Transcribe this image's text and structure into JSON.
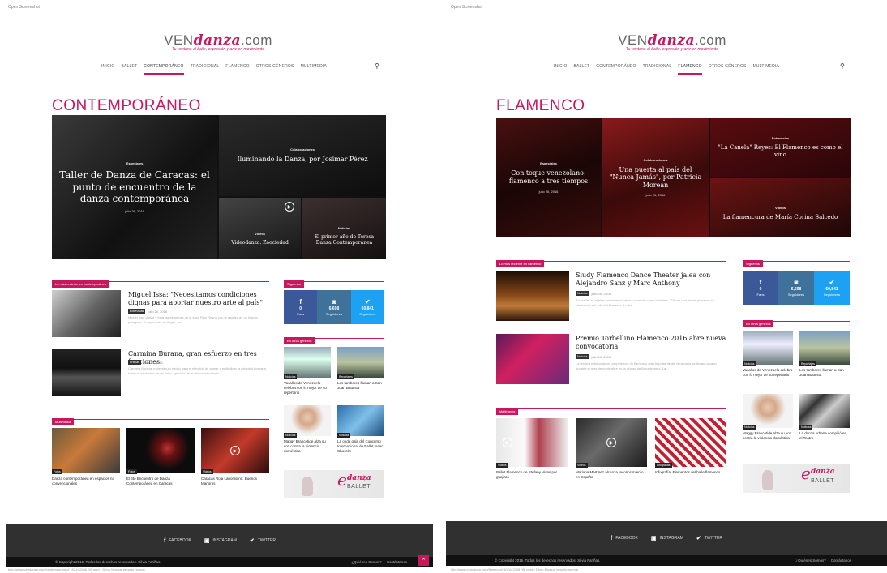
{
  "header": {
    "logo_ven": "VEN",
    "logo_danza": "danza",
    "logo_com": ".com",
    "tagline": "Tu ventana al baile, expresión y arte en movimiento",
    "search_icon": "search-icon"
  },
  "nav": [
    "INICIO",
    "BALLET",
    "CONTEMPORÁNEO",
    "TRADICIONAL",
    "FLAMENCO",
    "OTROS GÉNEROS",
    "MULTIMEDIA"
  ],
  "left": {
    "top_caption": "Open Screenshot",
    "page_title": "CONTEMPORÁNEO",
    "active_nav": "CONTEMPORÁNEO",
    "hero": [
      {
        "tag": "Especiales",
        "title": "Taller de Danza de Caracas: el punto de encuentro de la danza contemporánea",
        "date": "julio 26, 2016"
      },
      {
        "tag": "Colaboraciones",
        "title": "Iluminando la Danza, por Josimar Pérez"
      },
      {
        "tag": "Videos",
        "title": "Videodanza: Zoociedad"
      },
      {
        "tag": "Noticias",
        "title": "El primer año de Teresa Danza Contemporánea"
      }
    ],
    "latest_head": "Lo más reciente en contemporáneo",
    "articles": [
      {
        "title": "Miguel Issa: \"Necesitamos condiciones dignas para aportar nuestro arte al país\"",
        "cat": "Entrevistas",
        "date": "julio 26, 2016",
        "excerpt": "Miguel Issa danza y baja las escaleras de la casa Ríos Reyna con la rapidez de un halcón peregrino. Aunque está de negro, no..."
      },
      {
        "title": "Carmina Burana, gran esfuerzo en tres funciones",
        "cat": "Críticas",
        "date": "julio 26, 2016",
        "excerpt": "Carmina Burana, espectáculo hecho para el ejercicio de sumar y multiplicar la voluntad humana sobre el escenario en un único ejercicio de fe del conservatorio..."
      }
    ],
    "multimedia_head": "Multimedia",
    "multimedia": [
      {
        "cat": "Fotos",
        "caption": "Danza contemporánea en espacios no convencionales"
      },
      {
        "cat": "Fotos",
        "caption": "El 6to Encuentro de Danza Contemporánea en Caracas"
      },
      {
        "cat": "Videos",
        "caption": "Caracas Roja Laboratorio: Buenos Manoros"
      }
    ],
    "follow_head": "Síguenos",
    "social": [
      {
        "icon": "f",
        "count": "0",
        "label": "Fans"
      },
      {
        "icon": "◙",
        "count": "6,698",
        "label": "Seguidores"
      },
      {
        "icon": "✔",
        "count": "60,841",
        "label": "Seguidores"
      }
    ],
    "others_head": "En otros géneros",
    "others": [
      {
        "cat": "Noticias",
        "caption": "Vasallos de Venezuela celebra con lo mejor de su repertorio"
      },
      {
        "cat": "Reportajes",
        "caption": "Los tambores llaman a San Juan Bautista"
      },
      {
        "cat": "Noticias",
        "caption": "Maggy Brancetide alza su voz contra la violencia doméstica"
      },
      {
        "cat": "Noticias",
        "caption": "La onda gala del Concurso Internacional de Ballet Isaac Chocrón"
      }
    ],
    "bottom_caption": "http://www.vendanza.com/contemporaneo/ 1024×2208 (96 ppp) • Dim • Mostrar tamaño normal"
  },
  "right": {
    "top_caption": "Open Screenshot",
    "page_title": "FLAMENCO",
    "active_nav": "FLAMENCO",
    "hero": [
      {
        "tag": "Especiales",
        "title": "Con toque venezolano: flamenco a tres tiempos",
        "date": "julio 26, 2016"
      },
      {
        "tag": "Colaboraciones",
        "title": "Una puerta al país del \"Nunca Jamás\", por Patricia Moreán",
        "date": "julio 26, 2016"
      },
      {
        "tag": "Entrevistas",
        "title": "\"La Canela\" Reyes: El Flamenco es como el vino"
      },
      {
        "tag": "Videos",
        "title": "La flamencura de María Corina Salcedo"
      }
    ],
    "latest_head": "Lo más reciente en flamenco",
    "articles": [
      {
        "title": "Siudy Flamenco Dance Theater jalea con Alejandro Sanz y Marc Anthony",
        "cat": "Noticias",
        "date": "julio 26, 2016",
        "excerpt": "Su madre es el pilar fundamental de su vocación como bailarina. \"Ella es una de las pioneras en Venezuela del arte del flamenco. Lo fui..."
      },
      {
        "title": "Premio Torbellino Flamenco 2016 abre nueva convocatoria",
        "cat": "Noticias",
        "date": "julio 26, 2016",
        "excerpt": "La tercera edición de la competencia de flamenco más importante de Venezuela se llevará a cabo durante el mes de noviembre en la ciudad de Barquisimeto. La..."
      }
    ],
    "multimedia_head": "Multimedia",
    "multimedia": [
      {
        "cat": "Videos",
        "caption": "Ballet Flamenco de Stefany Vivas por guajiras"
      },
      {
        "cat": "Videos",
        "caption": "Mariana Martínez alcanza reconocimiento en España"
      },
      {
        "cat": "Infografías",
        "caption": "Infografía: Elementos del baile flamenco"
      }
    ],
    "follow_head": "Síguenos",
    "social": [
      {
        "icon": "f",
        "count": "0",
        "label": "Fans"
      },
      {
        "icon": "◙",
        "count": "6,698",
        "label": "Seguidores"
      },
      {
        "icon": "✔",
        "count": "60,841",
        "label": "Seguidores"
      }
    ],
    "others_head": "En otros géneros",
    "others": [
      {
        "cat": "Noticias",
        "caption": "Vasallos de Venezuela celebra con lo mejor de su repertorio"
      },
      {
        "cat": "Reportajes",
        "caption": "Los tambores llaman a San Juan Bautista"
      },
      {
        "cat": "Noticias",
        "caption": "Maggy Brancetide alza su voz contra la violencia doméstica"
      },
      {
        "cat": "Noticias",
        "caption": "La danza urbana compitió en el Teatro"
      }
    ],
    "bottom_caption": "http://www.vendanza.com/flamenco/ 1024×2208 (96 ppp) • Dim • Mostrar tamaño normal"
  },
  "ad": {
    "e": "e",
    "danza": "danza",
    "ballet": "BALLET"
  },
  "footer": {
    "facebook": "FACEBOOK",
    "instagram": "INSTAGRAM",
    "twitter": "TWITTER",
    "copyright": "© Copyright 2016. Todos los derechos reservados. Silvia Fariñas.",
    "about": "¿Quiénes Somos?",
    "contact": "Contáctanos"
  },
  "colors": {
    "accent": "#c8175d",
    "facebook": "#3b5998",
    "instagram": "#3f729b",
    "twitter": "#1da1f2",
    "footer": "#303030"
  }
}
